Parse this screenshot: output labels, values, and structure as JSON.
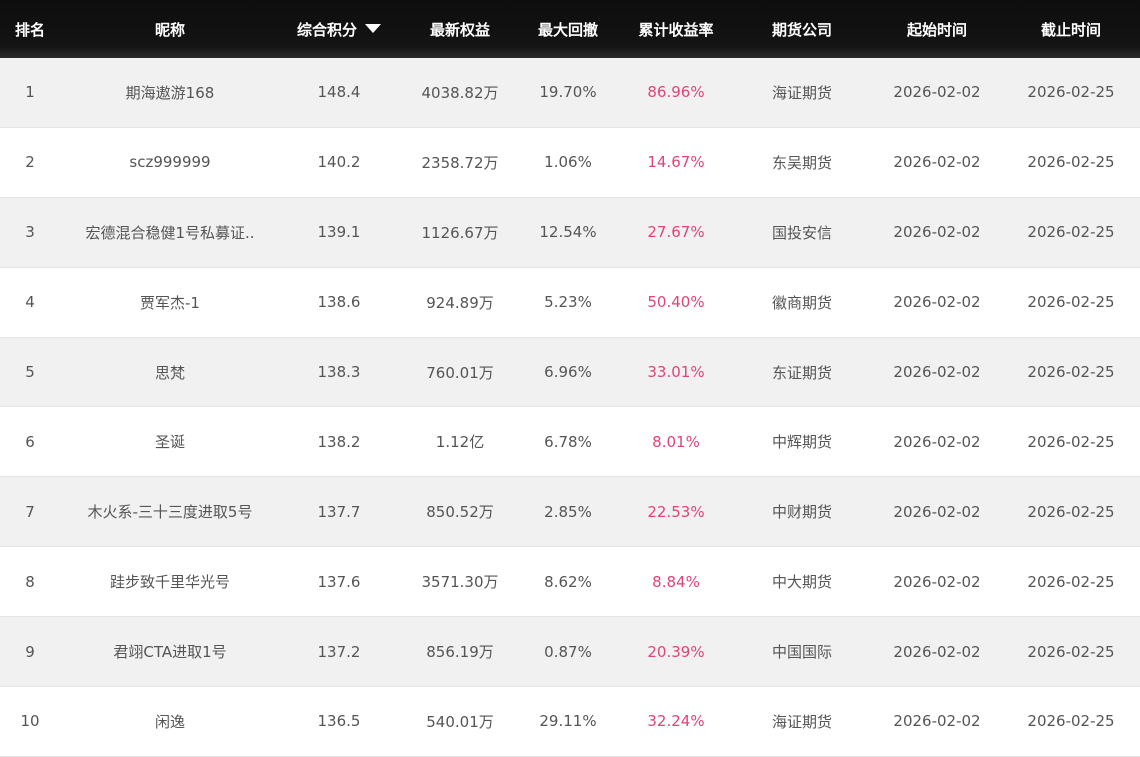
{
  "header": {
    "rank": "排名",
    "name": "昵称",
    "score": "综合积分",
    "equity": "最新权益",
    "drawdown": "最大回撤",
    "return": "累计收益率",
    "broker": "期货公司",
    "start": "起始时间",
    "end": "截止时间",
    "sort_icon": "caret-down-icon"
  },
  "rows": [
    {
      "rank": "1",
      "name": "期海遨游168",
      "score": "148.4",
      "equity": "4038.82万",
      "drawdown": "19.70%",
      "return": "86.96%",
      "broker": "海证期货",
      "start": "2026-02-02",
      "end": "2026-02-25"
    },
    {
      "rank": "2",
      "name": "scz999999",
      "score": "140.2",
      "equity": "2358.72万",
      "drawdown": "1.06%",
      "return": "14.67%",
      "broker": "东吴期货",
      "start": "2026-02-02",
      "end": "2026-02-25"
    },
    {
      "rank": "3",
      "name": "宏德混合稳健1号私募证..",
      "score": "139.1",
      "equity": "1126.67万",
      "drawdown": "12.54%",
      "return": "27.67%",
      "broker": "国投安信",
      "start": "2026-02-02",
      "end": "2026-02-25"
    },
    {
      "rank": "4",
      "name": "贾军杰-1",
      "score": "138.6",
      "equity": "924.89万",
      "drawdown": "5.23%",
      "return": "50.40%",
      "broker": "徽商期货",
      "start": "2026-02-02",
      "end": "2026-02-25"
    },
    {
      "rank": "5",
      "name": "思梵",
      "score": "138.3",
      "equity": "760.01万",
      "drawdown": "6.96%",
      "return": "33.01%",
      "broker": "东证期货",
      "start": "2026-02-02",
      "end": "2026-02-25"
    },
    {
      "rank": "6",
      "name": "圣诞",
      "score": "138.2",
      "equity": "1.12亿",
      "drawdown": "6.78%",
      "return": "8.01%",
      "broker": "中辉期货",
      "start": "2026-02-02",
      "end": "2026-02-25"
    },
    {
      "rank": "7",
      "name": "木火系-三十三度进取5号",
      "score": "137.7",
      "equity": "850.52万",
      "drawdown": "2.85%",
      "return": "22.53%",
      "broker": "中财期货",
      "start": "2026-02-02",
      "end": "2026-02-25"
    },
    {
      "rank": "8",
      "name": "跬步致千里华光号",
      "score": "137.6",
      "equity": "3571.30万",
      "drawdown": "8.62%",
      "return": "8.84%",
      "broker": "中大期货",
      "start": "2026-02-02",
      "end": "2026-02-25"
    },
    {
      "rank": "9",
      "name": "君翊CTA进取1号",
      "score": "137.2",
      "equity": "856.19万",
      "drawdown": "0.87%",
      "return": "20.39%",
      "broker": "中国国际",
      "start": "2026-02-02",
      "end": "2026-02-25"
    },
    {
      "rank": "10",
      "name": "闲逸",
      "score": "136.5",
      "equity": "540.01万",
      "drawdown": "29.11%",
      "return": "32.24%",
      "broker": "海证期货",
      "start": "2026-02-02",
      "end": "2026-02-25"
    }
  ],
  "colors": {
    "header_bg": "#111111",
    "row_odd_bg": "#f1f1f1",
    "row_even_bg": "#ffffff",
    "return_text": "#e0437a",
    "body_text": "#555555"
  }
}
